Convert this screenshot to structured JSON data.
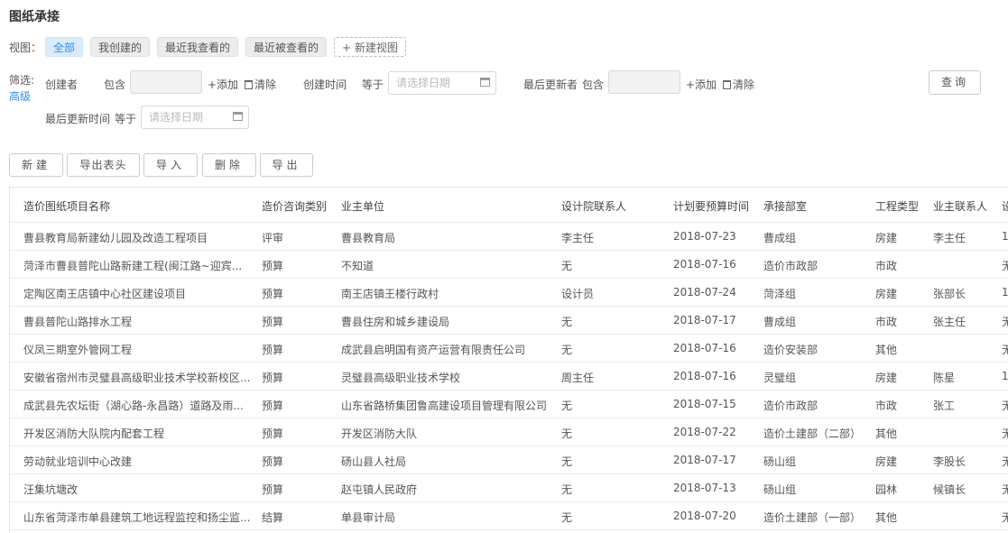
{
  "page": {
    "title": "图纸承接"
  },
  "views": {
    "label": "视图：",
    "tabs": [
      "全部",
      "我创建的",
      "最近我查看的",
      "最近被查看的"
    ],
    "new_view": "+ 新建视图"
  },
  "filter": {
    "label": "筛选:",
    "advanced": "高级",
    "creator": "创建者",
    "contains": "包含",
    "add": "+添加",
    "clear": "清除",
    "created_time": "创建时间",
    "equals": "等于",
    "date_placeholder": "请选择日期",
    "last_updater": "最后更新者",
    "last_update_time": "最后更新时间",
    "query_button": "查询"
  },
  "toolbar": {
    "new": "新建",
    "export_header": "导出表头",
    "import": "导入",
    "delete": "删除",
    "export": "导出"
  },
  "table": {
    "columns": [
      "造价图纸项目名称",
      "造价咨询类别",
      "业主单位",
      "设计院联系人",
      "计划要预算时间",
      "承接部室",
      "工程类型",
      "业主联系人",
      "设"
    ],
    "rows": [
      [
        "曹县教育局新建幼儿园及改造工程项目",
        "评审",
        "曹县教育局",
        "李主任",
        "2018-07-23",
        "曹成组",
        "房建",
        "李主任",
        "1"
      ],
      [
        "菏泽市曹县普陀山路新建工程(闽江路~迎宾...",
        "预算",
        "不知道",
        "无",
        "2018-07-16",
        "造价市政部",
        "市政",
        "",
        "无"
      ],
      [
        "定陶区南王店镇中心社区建设项目",
        "预算",
        "南王店镇王楼行政村",
        "设计员",
        "2018-07-24",
        "菏泽组",
        "房建",
        "张部长",
        "1"
      ],
      [
        "曹县普陀山路排水工程",
        "预算",
        "曹县住房和城乡建设局",
        "无",
        "2018-07-17",
        "曹成组",
        "市政",
        "张主任",
        "无"
      ],
      [
        "仪凤三期室外管网工程",
        "预算",
        "成武县启明国有资产运营有限责任公司",
        "无",
        "2018-07-16",
        "造价安装部",
        "其他",
        "",
        "无"
      ],
      [
        "安徽省宿州市灵璧县高级职业技术学校新校区...",
        "预算",
        "灵璧县高级职业技术学校",
        "周主任",
        "2018-07-16",
        "灵璧组",
        "房建",
        "陈星",
        "1"
      ],
      [
        "成武县先农坛街（湖心路-永昌路）道路及雨...",
        "预算",
        "山东省路桥集团鲁高建设项目管理有限公司",
        "无",
        "2018-07-15",
        "造价市政部",
        "市政",
        "张工",
        "无"
      ],
      [
        "开发区消防大队院内配套工程",
        "预算",
        "开发区消防大队",
        "无",
        "2018-07-22",
        "造价土建部（二部）",
        "其他",
        "",
        "无"
      ],
      [
        "劳动就业培训中心改建",
        "预算",
        "砀山县人社局",
        "无",
        "2018-07-17",
        "砀山组",
        "房建",
        "李股长",
        "无"
      ],
      [
        "汪集坑塘改",
        "预算",
        "赵屯镇人民政府",
        "无",
        "2018-07-13",
        "砀山组",
        "园林",
        "候镇长",
        "无"
      ],
      [
        "山东省菏泽市单县建筑工地远程监控和扬尘监...",
        "结算",
        "单县审计局",
        "无",
        "2018-07-20",
        "造价土建部（一部）",
        "其他",
        "",
        "无"
      ]
    ]
  }
}
